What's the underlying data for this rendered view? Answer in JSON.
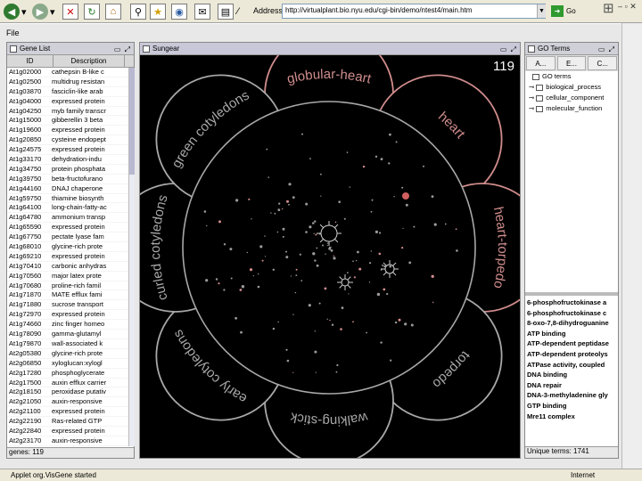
{
  "browser": {
    "address_label": "Address",
    "address_url": "http://virtualplant.bio.nyu.edu/cgi-bin/demo/ntest4/main.htm",
    "go_label": "Go",
    "status_text": "Applet org.VisGene started",
    "zone_text": "Internet"
  },
  "applet": {
    "file_menu": "File",
    "gene_panel": {
      "title": "Gene List",
      "col_id": "ID",
      "col_desc": "Description",
      "rows": [
        {
          "id": "At1g02000",
          "desc": "cathepsin B-like c"
        },
        {
          "id": "At1g02500",
          "desc": "multidrug resistan"
        },
        {
          "id": "At1g03870",
          "desc": "fasciclin-like arab"
        },
        {
          "id": "At1g04000",
          "desc": "expressed protein"
        },
        {
          "id": "At1g04250",
          "desc": "myb family transcr"
        },
        {
          "id": "At1g15000",
          "desc": "gibberellin 3 beta"
        },
        {
          "id": "At1g19600",
          "desc": "expressed protein"
        },
        {
          "id": "At1g20850",
          "desc": "cysteine endopept"
        },
        {
          "id": "At1g24575",
          "desc": "expressed protein"
        },
        {
          "id": "At1g33170",
          "desc": "dehydration-indu"
        },
        {
          "id": "At1g34750",
          "desc": "protein phosphata"
        },
        {
          "id": "At1g39750",
          "desc": "beta-fructofurano"
        },
        {
          "id": "At1g44160",
          "desc": "DNAJ chaperone"
        },
        {
          "id": "At1g59750",
          "desc": "thiamine biosynth"
        },
        {
          "id": "At1g64100",
          "desc": "long-chain-fatty-ac"
        },
        {
          "id": "At1g64780",
          "desc": "ammonium transp"
        },
        {
          "id": "At1g65590",
          "desc": "expressed protein"
        },
        {
          "id": "At1g67750",
          "desc": "pectate lyase fam"
        },
        {
          "id": "At1g68010",
          "desc": "glycine-rich prote"
        },
        {
          "id": "At1g69210",
          "desc": "expressed protein"
        },
        {
          "id": "At1g70410",
          "desc": "carbonic anhydras"
        },
        {
          "id": "At1g70560",
          "desc": "major latex prote"
        },
        {
          "id": "At1g70680",
          "desc": "proline-rich famil"
        },
        {
          "id": "At1g71870",
          "desc": "MATE efflux fami"
        },
        {
          "id": "At1g71880",
          "desc": "sucrose transport"
        },
        {
          "id": "At1g72970",
          "desc": "expressed protein"
        },
        {
          "id": "At1g74660",
          "desc": "zinc finger homeo"
        },
        {
          "id": "At1g78090",
          "desc": "gamma-glutamyl"
        },
        {
          "id": "At1g79870",
          "desc": "wall-associated k"
        },
        {
          "id": "At2g05380",
          "desc": "glycine-rich prote"
        },
        {
          "id": "At2g06850",
          "desc": "xyloglucan:xylogl"
        },
        {
          "id": "At2g17280",
          "desc": "phosphoglycerate"
        },
        {
          "id": "At2g17500",
          "desc": "auxin efflux carrier"
        },
        {
          "id": "At2g18150",
          "desc": "peroxidase putativ"
        },
        {
          "id": "At2g21050",
          "desc": "auxin-responsive"
        },
        {
          "id": "At2g21100",
          "desc": "expressed protein"
        },
        {
          "id": "At2g22190",
          "desc": "Ras-related GTP"
        },
        {
          "id": "At2g22840",
          "desc": "expressed protein"
        },
        {
          "id": "At2g23170",
          "desc": "auxin-responsive"
        }
      ],
      "footer": "genes: 119"
    },
    "sungear": {
      "title": "Sungear",
      "count": "119",
      "outer_labels": [
        "globular-heart",
        "heart",
        "heart-torpedo",
        "torpedo",
        "walking-stick",
        "early cotyledons",
        "curled cotyledons",
        "green cotyledons"
      ]
    },
    "go_panel": {
      "title": "GO Terms",
      "tabs": [
        "A...",
        "E...",
        "C..."
      ],
      "tree": [
        "GO terms",
        "biological_process",
        "cellular_component",
        "molecular_function"
      ],
      "list": [
        "6-phosphofructokinase a",
        "6-phosphofructokinase c",
        "8-oxo-7,8-dihydroguanine",
        "ATP binding",
        "ATP-dependent peptidase",
        "ATP-dependent proteolys",
        "ATPase activity, coupled",
        "DNA binding",
        "DNA repair",
        "DNA-3-methyladenine gly",
        "GTP binding",
        "Mre11 complex"
      ],
      "footer": "Unique terms: 1741"
    }
  },
  "colors": {
    "active_vessel": "#d08c8c",
    "inactive_vessel": "#a8a8a8",
    "sungear_bg": "#000000"
  }
}
